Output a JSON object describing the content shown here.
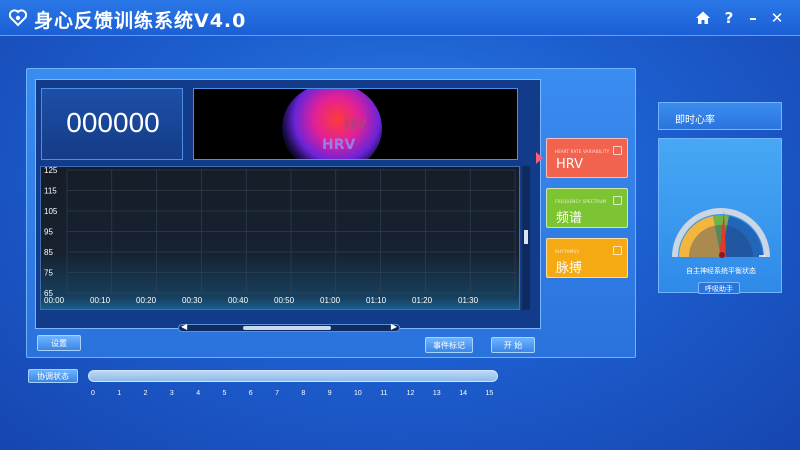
{
  "app": {
    "title": "身心反馈训练系统V4.0"
  },
  "window": {
    "home_icon": "home-icon",
    "help_label": "?",
    "minimize_label": "–",
    "close_label": "✕"
  },
  "display": {
    "counter": "000000",
    "overlay_label": "HRV",
    "overlay_label2": "HV"
  },
  "chart_data": {
    "type": "line",
    "xlabel": "",
    "ylabel": "",
    "y_ticks": [
      "125",
      "115",
      "105",
      "95",
      "85",
      "75",
      "65"
    ],
    "x_ticks": [
      "00:00",
      "00:10",
      "00:20",
      "00:30",
      "00:40",
      "00:50",
      "01:00",
      "01:10",
      "01:20",
      "01:30"
    ],
    "ylim": [
      65,
      125
    ],
    "grid": true,
    "series": []
  },
  "buttons": {
    "settings": "设置",
    "event_mark": "事件标记",
    "start": "开 始",
    "breath_assist": "呼吸助手"
  },
  "side_cards": [
    {
      "sub": "HEART RATE VARIABILITY",
      "label": "HRV",
      "color": "#f2634f"
    },
    {
      "sub": "FREQUENCY SPECTRUM",
      "label": "频谱",
      "color": "#7dc432"
    },
    {
      "sub": "RHYTHMUS",
      "label": "脉搏",
      "color": "#f5aa14"
    }
  ],
  "right_panel": {
    "header": "即时心率",
    "gauge_caption": "自主神经系统平衡状态"
  },
  "status": {
    "label": "协调状态",
    "scale": [
      "0",
      "1",
      "2",
      "3",
      "4",
      "5",
      "6",
      "7",
      "8",
      "9",
      "10",
      "11",
      "12",
      "13",
      "14",
      "15"
    ]
  }
}
